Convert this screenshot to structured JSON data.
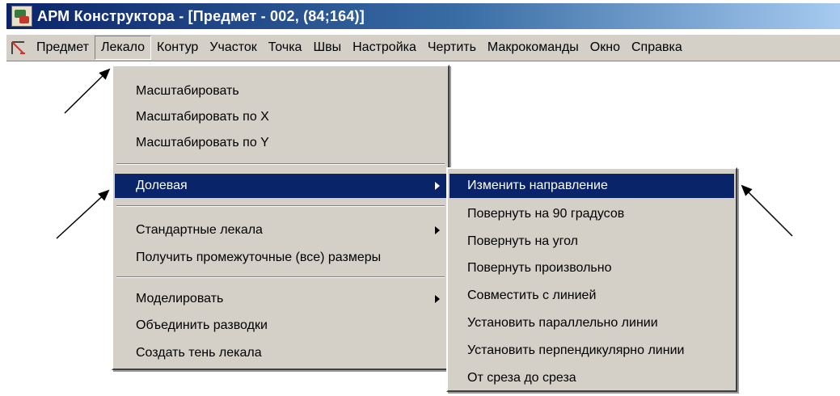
{
  "window": {
    "title": "АРМ Конструктора - [Предмет - 002,  (84;164)]",
    "icon": "app-icon"
  },
  "menubar": {
    "items": [
      {
        "label": "Предмет"
      },
      {
        "label": "Лекало",
        "active": true
      },
      {
        "label": "Контур"
      },
      {
        "label": "Участок"
      },
      {
        "label": "Точка"
      },
      {
        "label": "Швы"
      },
      {
        "label": "Настройка"
      },
      {
        "label": "Чертить"
      },
      {
        "label": "Макрокоманды"
      },
      {
        "label": "Окно"
      },
      {
        "label": "Справка"
      }
    ]
  },
  "dropdown": {
    "items": [
      {
        "label": "Масштабировать"
      },
      {
        "label": "Масштабировать по X"
      },
      {
        "label": "Масштабировать  по Y"
      },
      {
        "label": "Долевая",
        "selected": true,
        "submenu": true
      },
      {
        "label": "Стандартные лекала",
        "submenu": true
      },
      {
        "label": "Получить промежуточные (все)  размеры"
      },
      {
        "label": "Моделировать",
        "submenu": true
      },
      {
        "label": "Объединить разводки"
      },
      {
        "label": "Создать тень лекала"
      }
    ]
  },
  "submenu": {
    "items": [
      {
        "label": "Изменить направление",
        "selected": true
      },
      {
        "label": "Повернуть на 90 градусов"
      },
      {
        "label": "Повернуть на угол"
      },
      {
        "label": "Повернуть произвольно"
      },
      {
        "label": "Совместить с линией"
      },
      {
        "label": "Установить параллельно линии"
      },
      {
        "label": "Установить перпендикулярно линии"
      },
      {
        "label": "От среза до среза"
      }
    ]
  },
  "colors": {
    "titlebar": "#0a246a",
    "menu_bg": "#d4d0c8",
    "highlight": "#0a246a"
  }
}
